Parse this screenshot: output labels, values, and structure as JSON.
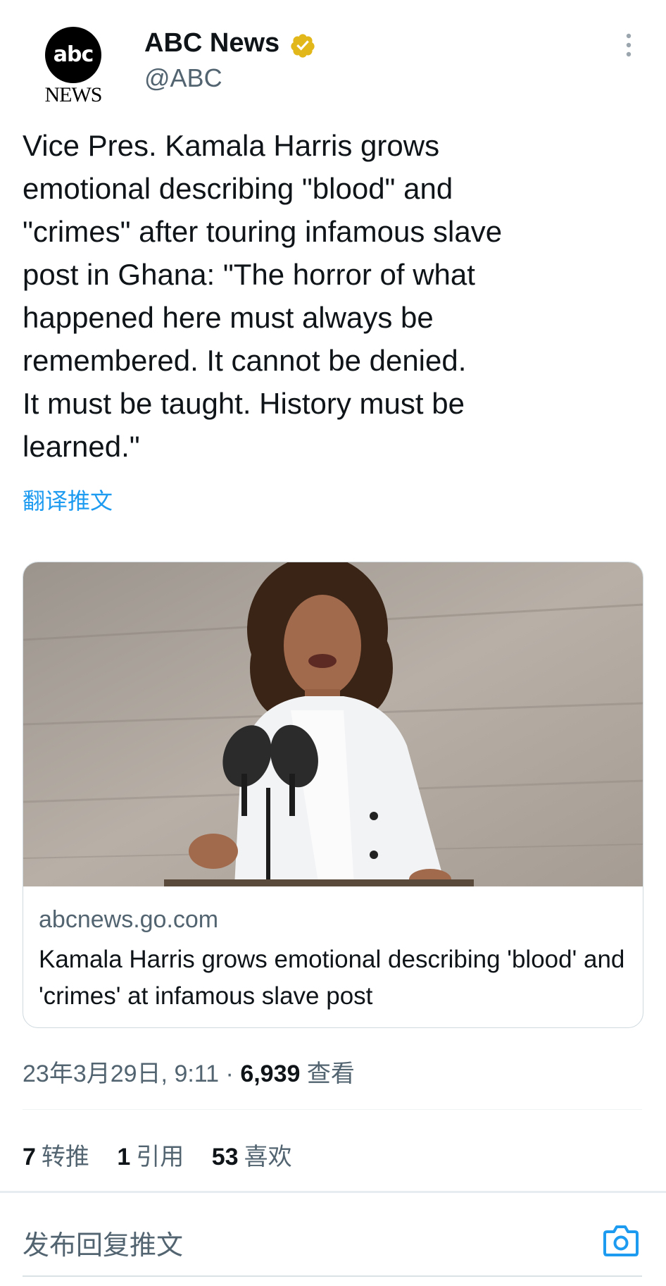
{
  "profile": {
    "avatar_logo": "abc",
    "avatar_sub": "NEWS",
    "display_name": "ABC News",
    "handle": "@ABC",
    "verified_icon": "verified-badge-icon",
    "more_icon": "more-vertical-icon"
  },
  "tweet": {
    "text": "Vice Pres. Kamala Harris grows\nemotional describing \"blood\" and\n\"crimes\" after touring infamous slave\npost in Ghana: \"The horror of what\nhappened here must always be\nremembered. It cannot be denied.\nIt must be taught. History must be\nlearned.\"",
    "translate_label": "翻译推文"
  },
  "card": {
    "image_icon": "news-photo-image",
    "domain": "abcnews.go.com",
    "title": "Kamala Harris grows emotional describing 'blood' and 'crimes' at infamous slave post"
  },
  "meta": {
    "timestamp": "23年3月29日, 9:11 · ",
    "views_count": "6,939",
    "views_label": " 查看"
  },
  "stats": [
    {
      "count": "7",
      "label": "转推"
    },
    {
      "count": "1",
      "label": "引用"
    },
    {
      "count": "53",
      "label": "喜欢"
    }
  ],
  "reply": {
    "placeholder": "发布回复推文",
    "camera_icon": "camera-icon"
  },
  "colors": {
    "accent": "#1d9bf0",
    "verified_gold": "#e2b719",
    "text_primary": "#0f1419",
    "text_secondary": "#536471"
  }
}
